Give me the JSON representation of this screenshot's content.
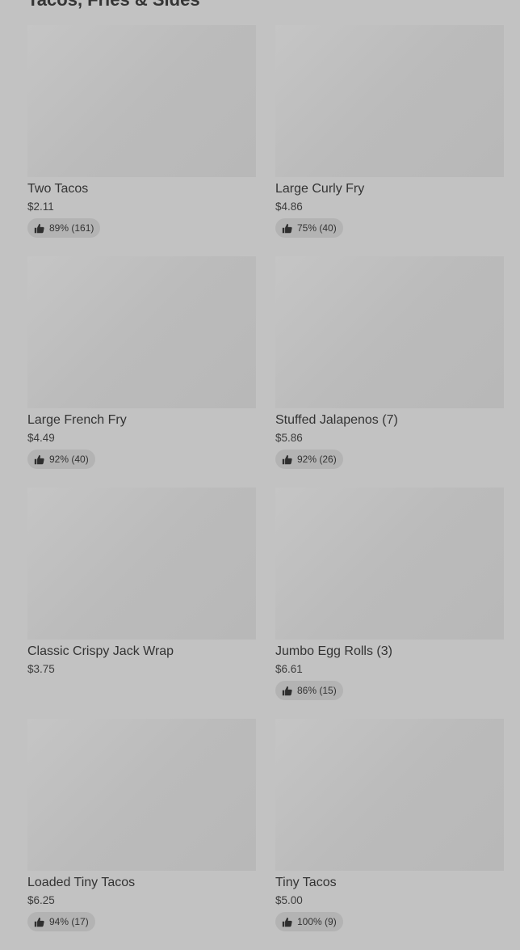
{
  "section": {
    "title": "Tacos, Fries & Sides"
  },
  "items": [
    {
      "name": "Two Tacos",
      "price": "$2.11",
      "rating": "89% (161)"
    },
    {
      "name": "Large Curly Fry",
      "price": "$4.86",
      "rating": "75% (40)"
    },
    {
      "name": "Large French Fry",
      "price": "$4.49",
      "rating": "92% (40)"
    },
    {
      "name": "Stuffed Jalapenos (7)",
      "price": "$5.86",
      "rating": "92% (26)"
    },
    {
      "name": "Classic Crispy Jack Wrap",
      "price": "$3.75",
      "rating": null
    },
    {
      "name": "Jumbo Egg Rolls (3)",
      "price": "$6.61",
      "rating": "86% (15)"
    },
    {
      "name": "Loaded Tiny Tacos",
      "price": "$6.25",
      "rating": "94% (17)"
    },
    {
      "name": "Tiny Tacos",
      "price": "$5.00",
      "rating": "100% (9)"
    }
  ],
  "icons": {
    "rating": "thumbs-up-icon"
  }
}
